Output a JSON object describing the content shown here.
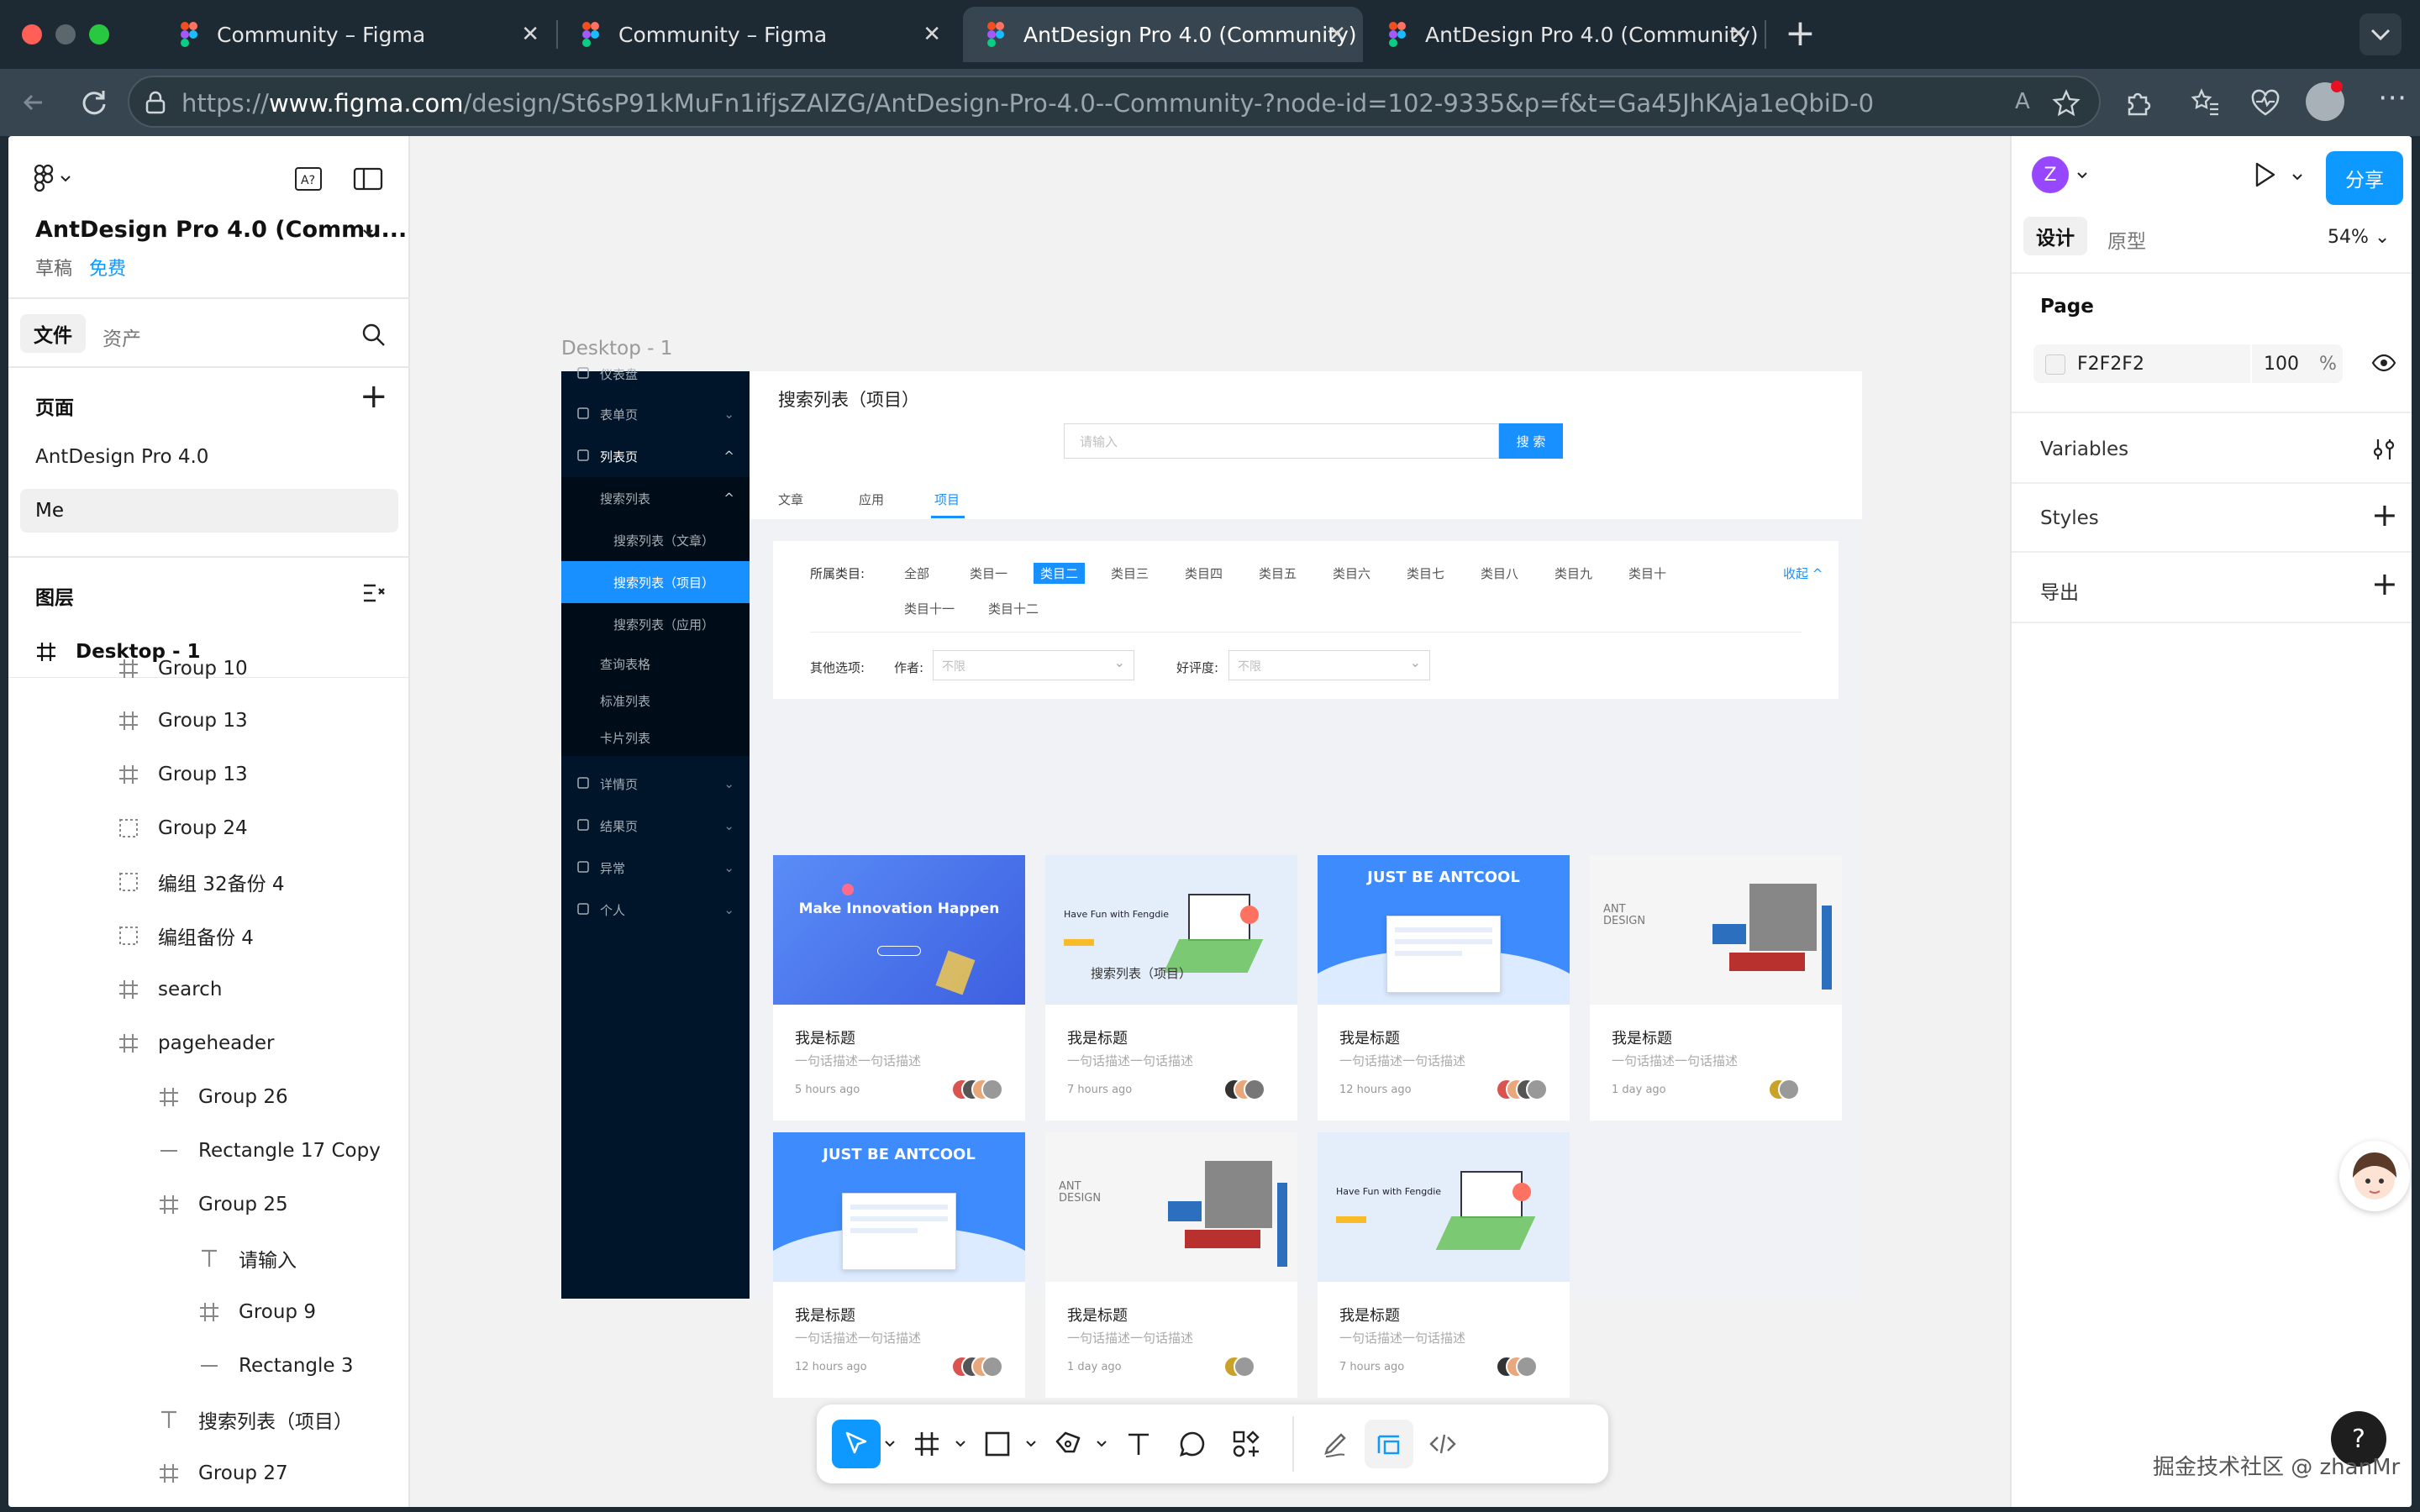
{
  "browser": {
    "tabs": [
      {
        "title": "Community – Figma"
      },
      {
        "title": "Community – Figma"
      },
      {
        "title": "AntDesign Pro 4.0 (Community)"
      },
      {
        "title": "AntDesign Pro 4.0 (Community)"
      }
    ],
    "url_prefix": "https://",
    "url_host": "www.figma.com",
    "url_path": "/design/St6sP91kMuFn1ifjsZAIZG/AntDesign-Pro-4.0--Community-?node-id=102-9335&p=f&t=Ga45JhKAja1eQbiD-0"
  },
  "left_panel": {
    "file_name": "AntDesign Pro 4.0 (Commu...",
    "draft_label": "草稿",
    "plan_label": "免费",
    "tab_files": "文件",
    "tab_assets": "资产",
    "pages_title": "页面",
    "pages": [
      "AntDesign Pro 4.0",
      "Me"
    ],
    "layers_title": "图层",
    "frame_name": "Desktop - 1",
    "layers": [
      {
        "name": "Group 10",
        "icon": "frame-icon"
      },
      {
        "name": "Group 13",
        "icon": "frame-icon"
      },
      {
        "name": "Group 13",
        "icon": "frame-icon"
      },
      {
        "name": "Group 24",
        "icon": "group-icon"
      },
      {
        "name": "编组 32备份 4",
        "icon": "group-icon"
      },
      {
        "name": "编组备份 4",
        "icon": "group-icon"
      },
      {
        "name": "search",
        "icon": "frame-icon"
      },
      {
        "name": "pageheader",
        "icon": "frame-icon"
      },
      {
        "name": "Group 26",
        "icon": "frame-icon"
      },
      {
        "name": "Rectangle 17 Copy",
        "icon": "line-icon"
      },
      {
        "name": "Group 25",
        "icon": "frame-icon"
      },
      {
        "name": "请输入",
        "icon": "text-icon"
      },
      {
        "name": "Group 9",
        "icon": "frame-icon"
      },
      {
        "name": "Rectangle 3",
        "icon": "line-icon"
      },
      {
        "name": "搜索列表（项目）",
        "icon": "text-icon"
      },
      {
        "name": "Group 27",
        "icon": "frame-icon"
      }
    ]
  },
  "canvas": {
    "frame_label": "Desktop - 1",
    "nav": {
      "item0": "仪表盘",
      "item1": "表单页",
      "item2": "列表页",
      "item3": "搜索列表",
      "item4": "搜索列表（文章）",
      "item5": "搜索列表（项目）",
      "item6": "搜索列表（应用）",
      "item7": "查询表格",
      "item8": "标准列表",
      "item9": "卡片列表",
      "item10": "详情页",
      "item11": "结果页",
      "item12": "异常",
      "item13": "个人"
    },
    "page_title": "搜索列表（项目）",
    "search_placeholder": "请输入",
    "search_button": "搜 索",
    "tabs": [
      "文章",
      "应用",
      "项目"
    ],
    "category_label": "所属类目:",
    "categories": [
      "全部",
      "类目一",
      "类目二",
      "类目三",
      "类目四",
      "类目五",
      "类目六",
      "类目七",
      "类目八",
      "类目九",
      "类目十",
      "类目十一",
      "类目十二"
    ],
    "collapse_label": "收起",
    "other_label": "其他选项:",
    "author_label": "作者:",
    "rating_label": "好评度:",
    "select_placeholder": "不限",
    "cards": [
      {
        "title": "我是标题",
        "desc": "一句话描述一句话描述",
        "time": "5 hours ago",
        "banner": "Make Innovation Happen"
      },
      {
        "title": "我是标题",
        "desc": "一句话描述一句话描述",
        "time": "7 hours ago",
        "banner": "Have Fun with Fengdie"
      },
      {
        "title": "我是标题",
        "desc": "一句话描述一句话描述",
        "time": "12 hours ago",
        "banner": "JUST BE ANTCOOL"
      },
      {
        "title": "我是标题",
        "desc": "一句话描述一句话描述",
        "time": "1 day ago",
        "banner": "ANT DESIGN"
      },
      {
        "title": "我是标题",
        "desc": "一句话描述一句话描述",
        "time": "12 hours ago",
        "banner": "JUST BE ANTCOOL"
      },
      {
        "title": "我是标题",
        "desc": "一句话描述一句话描述",
        "time": "1 day ago",
        "banner": "ANT DESIGN"
      },
      {
        "title": "我是标题",
        "desc": "一句话描述一句话描述",
        "time": "7 hours ago",
        "banner": "Have Fun with Fengdie"
      }
    ],
    "overlay_text": "搜索列表（项目）"
  },
  "right_panel": {
    "avatar_letter": "Z",
    "share_button": "分享",
    "tab_design": "设计",
    "tab_prototype": "原型",
    "zoom": "54%",
    "page_section": "Page",
    "page_color": "F2F2F2",
    "page_opacity": "100",
    "percent_sign": "%",
    "variables": "Variables",
    "styles": "Styles",
    "export": "导出"
  },
  "watermark": "掘金技术社区 @ zhanMr",
  "help_label": "?",
  "colors": {
    "accent": "#1890ff",
    "share_blue": "#0d99ff",
    "nav_dark": "#001529",
    "avatar_purple": "#9747ff"
  }
}
